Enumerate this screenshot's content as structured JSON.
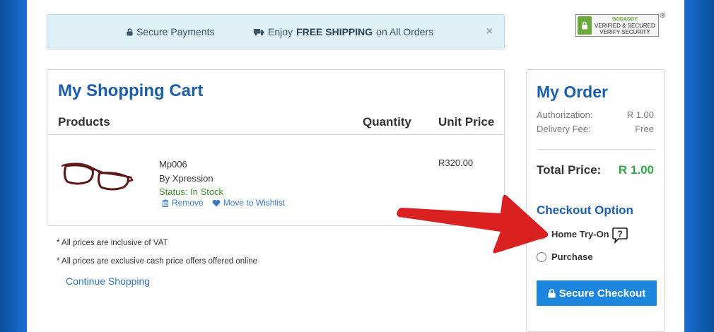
{
  "banner": {
    "secure_payments": "Secure Payments",
    "enjoy": "Enjoy",
    "free_shipping": "FREE SHIPPING",
    "on_all_orders": "on All Orders",
    "close": "×"
  },
  "badge": {
    "brand": "GODADDY",
    "line1": "VERIFIED & SECURED",
    "line2": "VERIFY SECURITY",
    "registered": "®"
  },
  "cart": {
    "title": "My Shopping Cart",
    "columns": {
      "products": "Products",
      "quantity": "Quantity",
      "unit_price": "Unit Price"
    },
    "item": {
      "name": "Mp006",
      "brand": "By Xpression",
      "status_label": "Status:",
      "status_value": "In Stock",
      "remove": "Remove",
      "wishlist": "Move to Wishlist",
      "unit_price": "R320.00"
    },
    "notes": [
      "* All prices are inclusive of VAT",
      "* All prices are exclusive cash price offers offered online"
    ],
    "continue": "Continue Shopping"
  },
  "order": {
    "title": "My Order",
    "authorization_label": "Authorization:",
    "authorization_value": "R 1.00",
    "delivery_label": "Delivery Fee:",
    "delivery_value": "Free",
    "total_label": "Total Price:",
    "total_value": "R 1.00",
    "checkout_option": "Checkout Option",
    "options": [
      "Home Try-On",
      "Purchase"
    ],
    "selected": "Home Try-On",
    "help": "?",
    "button": "Secure Checkout"
  },
  "colors": {
    "accent": "#1b5fab",
    "button": "#1d86dd",
    "green": "#36a54a",
    "arrow": "#d92121"
  }
}
